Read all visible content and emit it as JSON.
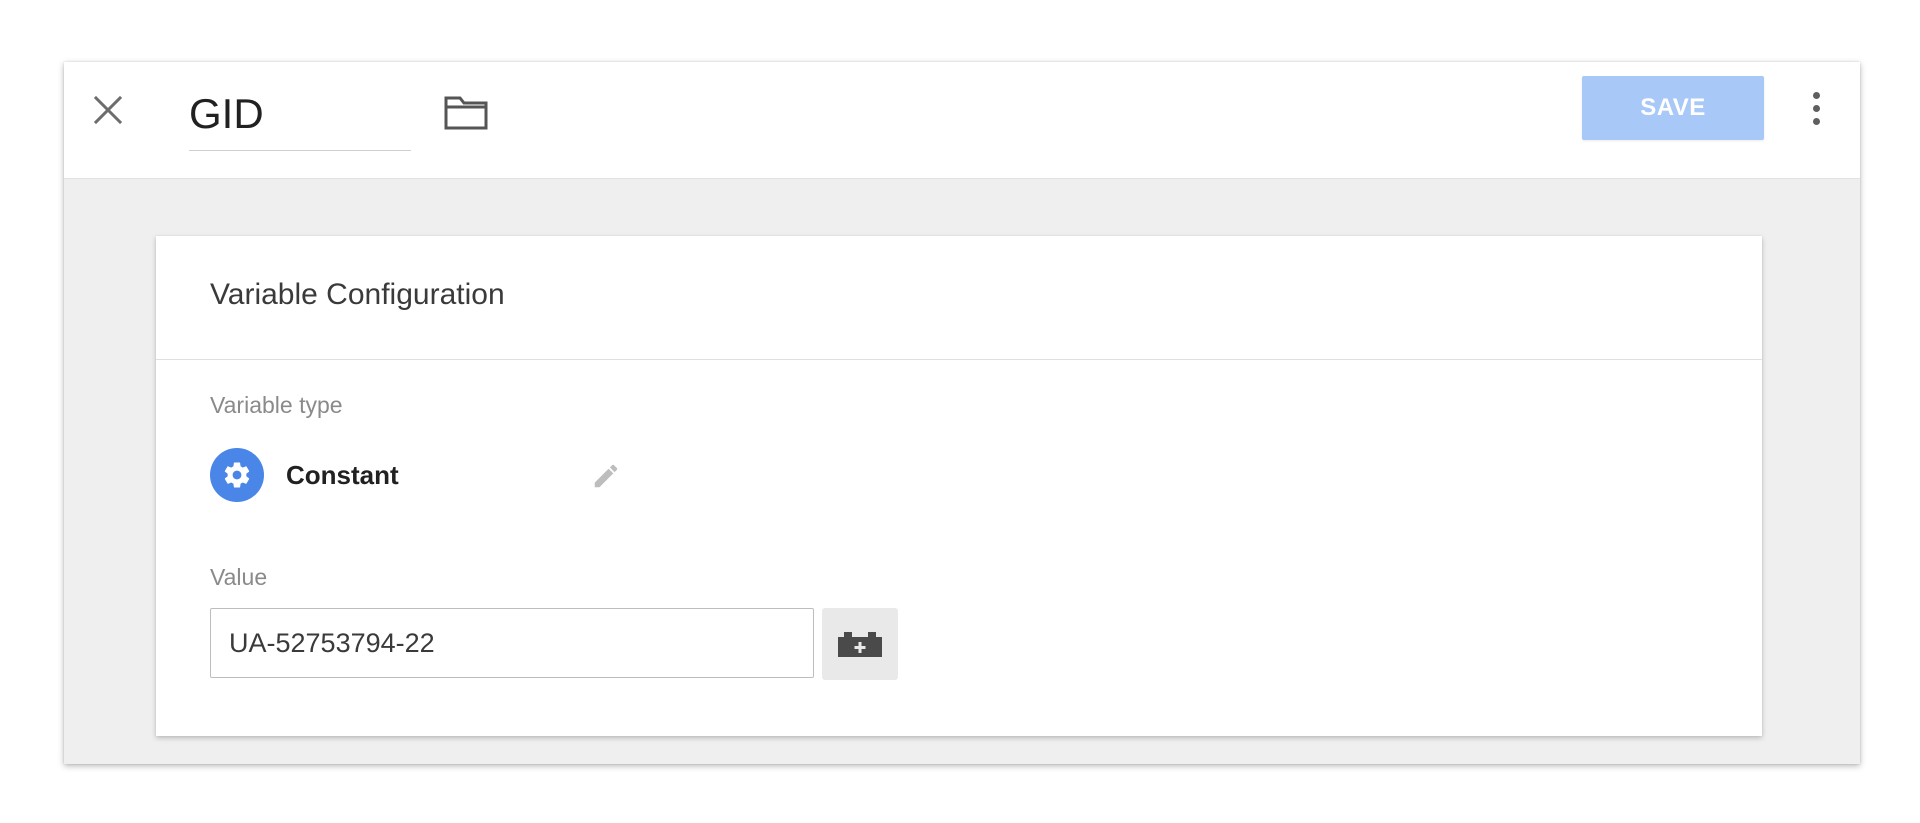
{
  "header": {
    "variable_name": "GID",
    "save_label": "SAVE",
    "save_color": "#a8c8f7"
  },
  "icons": {
    "close": "close-icon",
    "folder": "folder-icon",
    "more": "more-vert-icon",
    "type": "gear-icon",
    "edit": "pencil-icon",
    "variable_picker": "add-variable-block-icon"
  },
  "card": {
    "title": "Variable Configuration",
    "variable_type_label": "Variable type",
    "variable_type_value": "Constant",
    "variable_type_color": "#4a86e8",
    "value_label": "Value",
    "value": "UA-52753794-22"
  }
}
